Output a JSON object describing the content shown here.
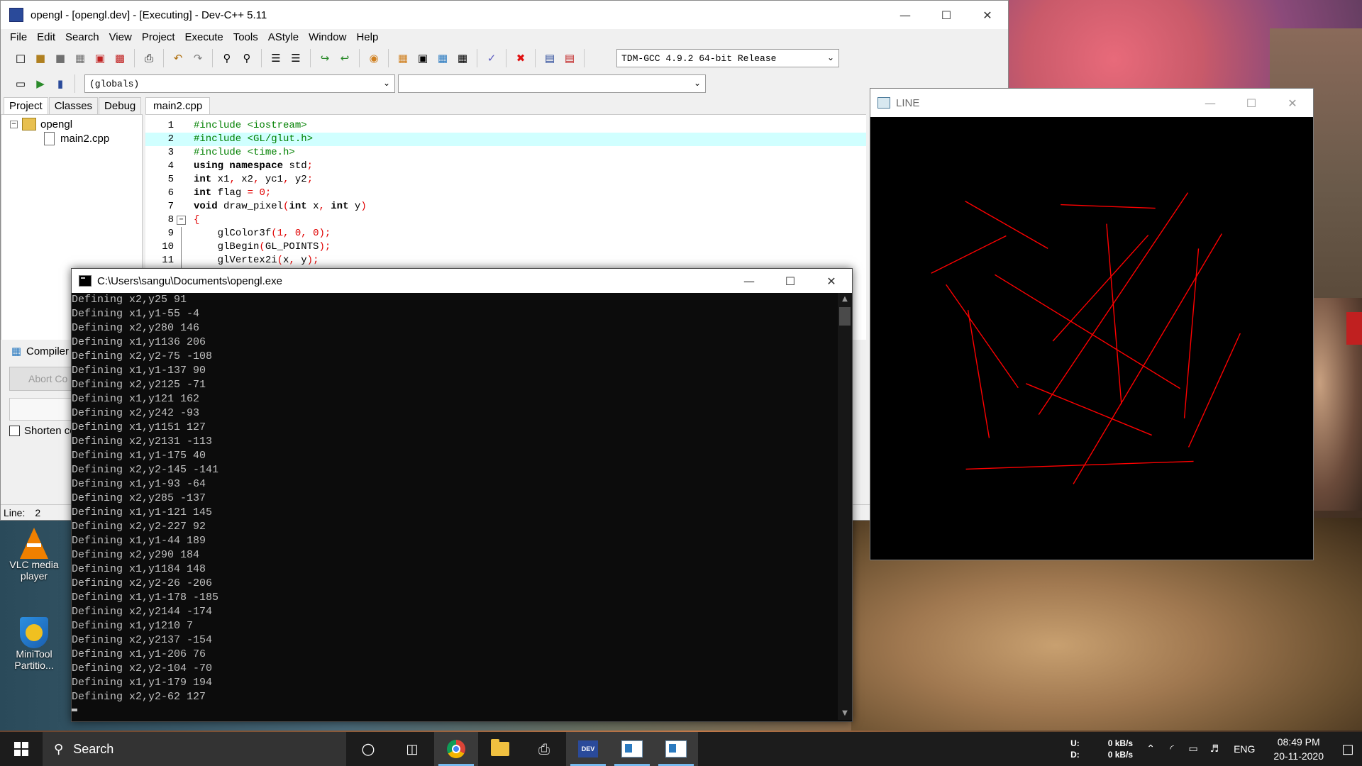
{
  "devcpp": {
    "title": "opengl - [opengl.dev] - [Executing] - Dev-C++ 5.11",
    "menu": [
      "File",
      "Edit",
      "Search",
      "View",
      "Project",
      "Execute",
      "Tools",
      "AStyle",
      "Window",
      "Help"
    ],
    "compiler_select": "TDM-GCC 4.9.2 64-bit Release",
    "globals_select": "(globals)",
    "member_select": "",
    "left_tabs": [
      "Project",
      "Classes",
      "Debug"
    ],
    "project_name": "opengl",
    "project_file": "main2.cpp",
    "editor_tab": "main2.cpp",
    "compiler_tab_label": "Compiler",
    "abort_label": "Abort Co",
    "shorten_label": "Shorten co",
    "status_line_label": "Line:",
    "status_line_value": "2",
    "code_lines": [
      "#include <iostream>",
      "#include <GL/glut.h>",
      "#include <time.h>",
      "using namespace std;",
      "int x1, x2, yc1, y2;",
      "int flag = 0;",
      "void draw_pixel(int x, int y)",
      "{",
      "    glColor3f(1, 0, 0);",
      "    glBegin(GL_POINTS);",
      "    glVertex2i(x, y);"
    ],
    "line_numbers": [
      "1",
      "2",
      "3",
      "4",
      "5",
      "6",
      "7",
      "8",
      "9",
      "10",
      "11"
    ],
    "highlighted_line": 2
  },
  "console": {
    "title": "C:\\Users\\sangu\\Documents\\opengl.exe",
    "lines": [
      "Defining x2,y25 91",
      "Defining x1,y1-55 -4",
      "Defining x2,y280 146",
      "Defining x1,y1136 206",
      "Defining x2,y2-75 -108",
      "Defining x1,y1-137 90",
      "Defining x2,y2125 -71",
      "Defining x1,y121 162",
      "Defining x2,y242 -93",
      "Defining x1,y1151 127",
      "Defining x2,y2131 -113",
      "Defining x1,y1-175 40",
      "Defining x2,y2-145 -141",
      "Defining x1,y1-93 -64",
      "Defining x2,y285 -137",
      "Defining x1,y1-121 145",
      "Defining x2,y2-227 92",
      "Defining x1,y1-44 189",
      "Defining x2,y290 184",
      "Defining x1,y1184 148",
      "Defining x2,y2-26 -206",
      "Defining x1,y1-178 -185",
      "Defining x2,y2144 -174",
      "Defining x1,y1210 7",
      "Defining x2,y2137 -154",
      "Defining x1,y1-206 76",
      "Defining x2,y2-104 -70",
      "Defining x1,y1-179 194",
      "Defining x2,y2-62 127"
    ]
  },
  "glwindow": {
    "title": "LINE",
    "line_color": "#ff0000",
    "background": "#000000"
  },
  "desktop": {
    "icons": [
      {
        "label": "VLC media player"
      },
      {
        "label": "MiniTool Partitio..."
      }
    ]
  },
  "taskbar": {
    "search_text": "Search",
    "net_up_label": "U:",
    "net_up_value": "0 kB/s",
    "net_down_label": "D:",
    "net_down_value": "0 kB/s",
    "language": "ENG",
    "time": "08:49 PM",
    "date": "20-11-2020",
    "apps": [
      "cortana-icon",
      "task-view-icon",
      "chrome-icon",
      "file-explorer-icon",
      "print-icon",
      "devcpp-icon",
      "opengl-console-icon",
      "glut-window-icon"
    ]
  },
  "colors": {
    "accent": "#76b9ed",
    "highlight_line": "#d0ffff",
    "preprocessor": "#008000",
    "number": "#e00000"
  }
}
